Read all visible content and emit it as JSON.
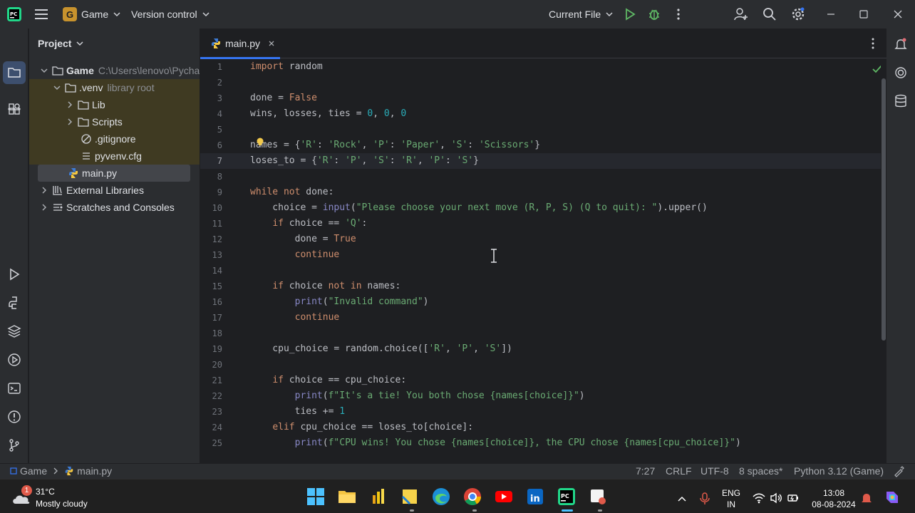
{
  "titlebar": {
    "project_badge": "G",
    "project_name": "Game",
    "version_control": "Version control",
    "run_config": "Current File"
  },
  "project_panel": {
    "title": "Project",
    "items": [
      {
        "label": "Game",
        "hint": "C:\\Users\\lenovo\\Pycha"
      },
      {
        "label": ".venv",
        "hint": "library root"
      },
      {
        "label": "Lib"
      },
      {
        "label": "Scripts"
      },
      {
        "label": ".gitignore"
      },
      {
        "label": "pyvenv.cfg"
      },
      {
        "label": "main.py"
      },
      {
        "label": "External Libraries"
      },
      {
        "label": "Scratches and Consoles"
      }
    ]
  },
  "editor": {
    "tab_label": "main.py",
    "current_line": 7,
    "line_numbers": [
      "1",
      "2",
      "3",
      "4",
      "5",
      "6",
      "7",
      "8",
      "9",
      "10",
      "11",
      "12",
      "13",
      "14",
      "15",
      "16",
      "17",
      "18",
      "19",
      "20",
      "21",
      "22",
      "23",
      "24",
      "25"
    ],
    "lines": [
      "import random",
      "",
      "done = False",
      "wins, losses, ties = 0, 0, 0",
      "",
      "names = {'R': 'Rock', 'P': 'Paper', 'S': 'Scissors'}",
      "loses_to = {'R': 'P', 'S': 'R', 'P': 'S'}",
      "",
      "while not done:",
      "    choice = input(\"Please choose your next move (R, P, S) (Q to quit): \").upper()",
      "    if choice == 'Q':",
      "        done = True",
      "        continue",
      "",
      "    if choice not in names:",
      "        print(\"Invalid command\")",
      "        continue",
      "",
      "    cpu_choice = random.choice(['R', 'P', 'S'])",
      "",
      "    if choice == cpu_choice:",
      "        print(f\"It's a tie! You both chose {names[choice]}\")",
      "        ties += 1",
      "    elif cpu_choice == loses_to[choice]:",
      "        print(f\"CPU wins! You chose {names[choice]}, the CPU chose {names[cpu_choice]}\")"
    ]
  },
  "statusbar": {
    "breadcrumb_project": "Game",
    "breadcrumb_file": "main.py",
    "position": "7:27",
    "line_ending": "CRLF",
    "encoding": "UTF-8",
    "indent": "8 spaces*",
    "interpreter": "Python 3.12 (Game)"
  },
  "taskbar": {
    "weather_badge": "1",
    "temperature": "31°C",
    "weather": "Mostly cloudy",
    "language_line1": "ENG",
    "language_line2": "IN",
    "time": "13:08",
    "date": "08-08-2024"
  },
  "colors": {
    "accent": "#3574f0",
    "keyword": "#cf8e6d",
    "string": "#6aab73",
    "number": "#2aacb8"
  }
}
